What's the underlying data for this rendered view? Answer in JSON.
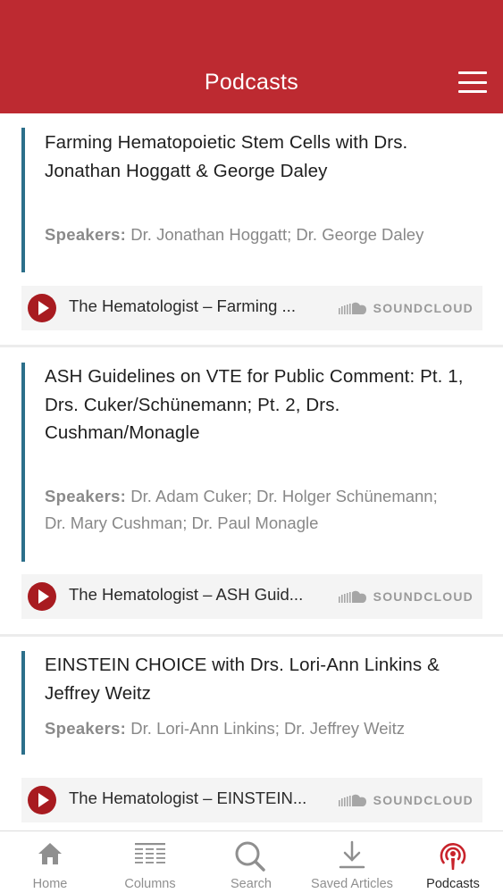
{
  "header": {
    "title": "Podcasts",
    "menu_icon": "hamburger-menu-icon"
  },
  "podcasts": [
    {
      "title": "Farming Hematopoietic Stem Cells with Drs. Jonathan Hoggatt & George Daley",
      "speakers_label": "Speakers:",
      "speakers": "Dr. Jonathan Hoggatt; Dr. George Daley",
      "track": "The Hematologist – Farming ...",
      "provider": "SOUNDCLOUD"
    },
    {
      "title": "ASH Guidelines on VTE for Public Comment: Pt. 1, Drs. Cuker/Schünemann; Pt. 2, Drs. Cushman/Monagle",
      "speakers_label": "Speakers:",
      "speakers": "Dr. Adam Cuker; Dr. Holger Schünemann; Dr. Mary Cushman; Dr. Paul Monagle",
      "track": "The Hematologist – ASH Guid...",
      "provider": "SOUNDCLOUD"
    },
    {
      "title": "EINSTEIN CHOICE with Drs. Lori-Ann Linkins & Jeffrey Weitz",
      "speakers_label": "Speakers:",
      "speakers": "Dr. Lori-Ann Linkins; Dr. Jeffrey Weitz",
      "track": "The Hematologist – EINSTEIN...",
      "provider": "SOUNDCLOUD"
    }
  ],
  "tabs": [
    {
      "label": "Home",
      "icon": "home-icon"
    },
    {
      "label": "Columns",
      "icon": "columns-icon"
    },
    {
      "label": "Search",
      "icon": "search-icon"
    },
    {
      "label": "Saved Articles",
      "icon": "download-icon"
    },
    {
      "label": "Podcasts",
      "icon": "podcast-icon",
      "active": true
    }
  ],
  "colors": {
    "brand": "#bd2a31",
    "accent": "#2c6f8a",
    "play": "#a81b20",
    "active_tab": "#c8232b"
  }
}
